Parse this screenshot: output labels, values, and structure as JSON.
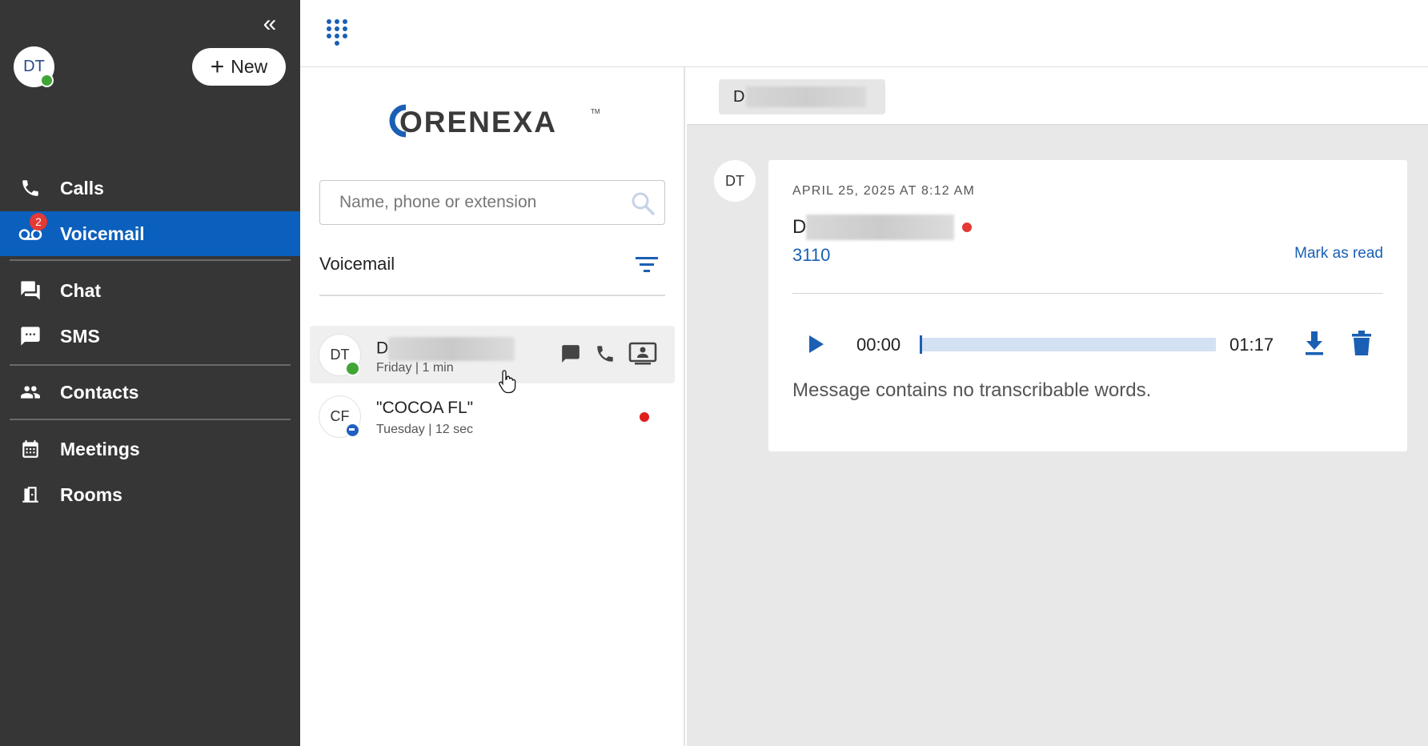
{
  "sidebar": {
    "user_initials": "DT",
    "new_button_label": "New",
    "nav": [
      {
        "label": "Calls"
      },
      {
        "label": "Voicemail",
        "badge": "2"
      },
      {
        "label": "Chat"
      },
      {
        "label": "SMS"
      },
      {
        "label": "Contacts"
      },
      {
        "label": "Meetings"
      },
      {
        "label": "Rooms"
      }
    ]
  },
  "brand": {
    "logo_text": "CORENEXA",
    "trademark": "TM"
  },
  "search": {
    "placeholder": "Name, phone or extension"
  },
  "voicemail_list": {
    "title": "Voicemail",
    "items": [
      {
        "initials": "DT",
        "name_prefix": "D",
        "meta": "Friday | 1 min",
        "presence": "online"
      },
      {
        "initials": "CF",
        "name": "\"COCOA FL\"",
        "meta": "Tuesday | 12 sec",
        "presence": "dnd",
        "unread": true
      }
    ]
  },
  "detail": {
    "contact_chip_prefix": "D",
    "avatar_initials": "DT",
    "date": "APRIL 25, 2025 AT 8:12 AM",
    "name_prefix": "D",
    "extension": "3110",
    "mark_as_read": "Mark as read",
    "player": {
      "current_time": "00:00",
      "total_time": "01:17",
      "progress": 0
    },
    "transcript": "Message contains no transcribable words."
  },
  "colors": {
    "sidebar_bg": "#363636",
    "accent": "#0b5fbd",
    "link": "#1a5fb4",
    "online": "#3fa535",
    "unread": "#e01e1e"
  }
}
